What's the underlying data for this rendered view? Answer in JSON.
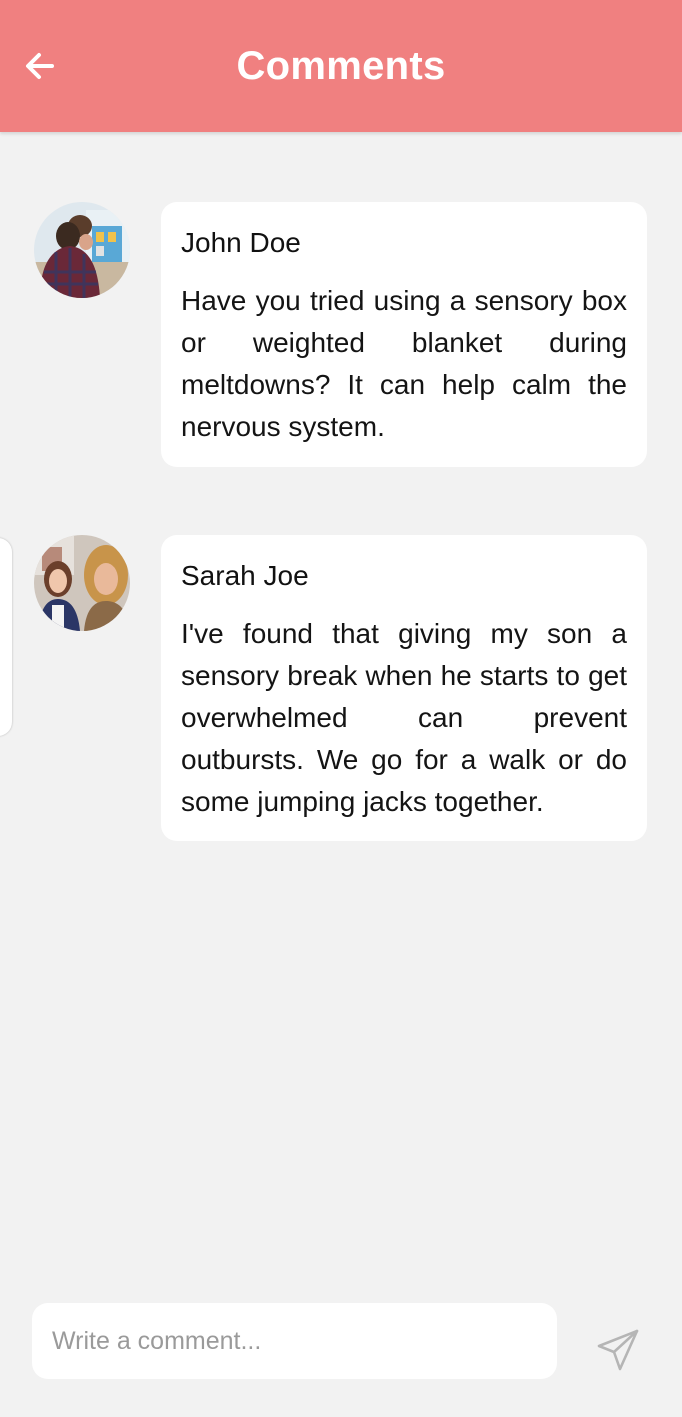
{
  "header": {
    "title": "Comments",
    "back_icon": "arrow-left-icon",
    "background": "#f08080"
  },
  "comments": [
    {
      "author": "John Doe",
      "avatar_icon": "user-avatar",
      "text": "Have you tried using a sensory box or weighted blanket during meltdowns? It can help calm the nervous system."
    },
    {
      "author": "Sarah Joe",
      "avatar_icon": "user-avatar",
      "text": "I've found that giving my son a sensory break when he starts to get overwhelmed can prevent outbursts. We go for a walk or do some jumping jacks together."
    }
  ],
  "composer": {
    "placeholder": "Write a comment...",
    "value": "",
    "send_icon": "send-icon"
  }
}
